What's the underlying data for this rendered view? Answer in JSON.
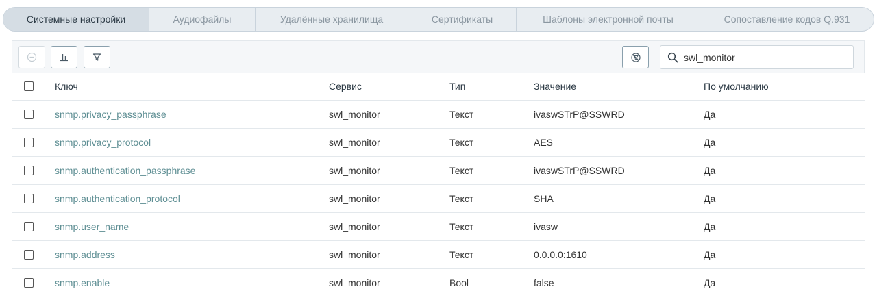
{
  "tabs": [
    {
      "label": "Системные настройки",
      "active": true
    },
    {
      "label": "Аудиофайлы",
      "active": false
    },
    {
      "label": "Удалённые хранилища",
      "active": false
    },
    {
      "label": "Сертификаты",
      "active": false
    },
    {
      "label": "Шаблоны электронной почты",
      "active": false
    },
    {
      "label": "Сопоставление кодов Q.931",
      "active": false
    }
  ],
  "toolbar": {
    "buttons": [
      {
        "icon": "minus-circle-icon",
        "disabled": true
      },
      {
        "icon": "columns-icon",
        "disabled": false
      },
      {
        "icon": "filter-icon",
        "disabled": false
      }
    ],
    "reset_filter_icon": "filter-off-icon",
    "search": {
      "icon": "search-icon",
      "value": "swl_monitor"
    }
  },
  "table": {
    "columns": [
      "Ключ",
      "Сервис",
      "Тип",
      "Значение",
      "По умолчанию"
    ],
    "rows": [
      {
        "key": "snmp.privacy_passphrase",
        "service": "swl_monitor",
        "type": "Текст",
        "value": "ivaswSTrP@SSWRD",
        "default": "Да"
      },
      {
        "key": "snmp.privacy_protocol",
        "service": "swl_monitor",
        "type": "Текст",
        "value": "AES",
        "default": "Да"
      },
      {
        "key": "snmp.authentication_passphrase",
        "service": "swl_monitor",
        "type": "Текст",
        "value": "ivaswSTrP@SSWRD",
        "default": "Да"
      },
      {
        "key": "snmp.authentication_protocol",
        "service": "swl_monitor",
        "type": "Текст",
        "value": "SHA",
        "default": "Да"
      },
      {
        "key": "snmp.user_name",
        "service": "swl_monitor",
        "type": "Текст",
        "value": "ivasw",
        "default": "Да"
      },
      {
        "key": "snmp.address",
        "service": "swl_monitor",
        "type": "Текст",
        "value": "0.0.0.0:1610",
        "default": "Да"
      },
      {
        "key": "snmp.enable",
        "service": "swl_monitor",
        "type": "Bool",
        "value": "false",
        "default": "Да"
      }
    ]
  },
  "colors": {
    "link": "#5f8f94",
    "tab_active_bg": "#d5dde4",
    "tab_bg": "#e8edf1"
  }
}
